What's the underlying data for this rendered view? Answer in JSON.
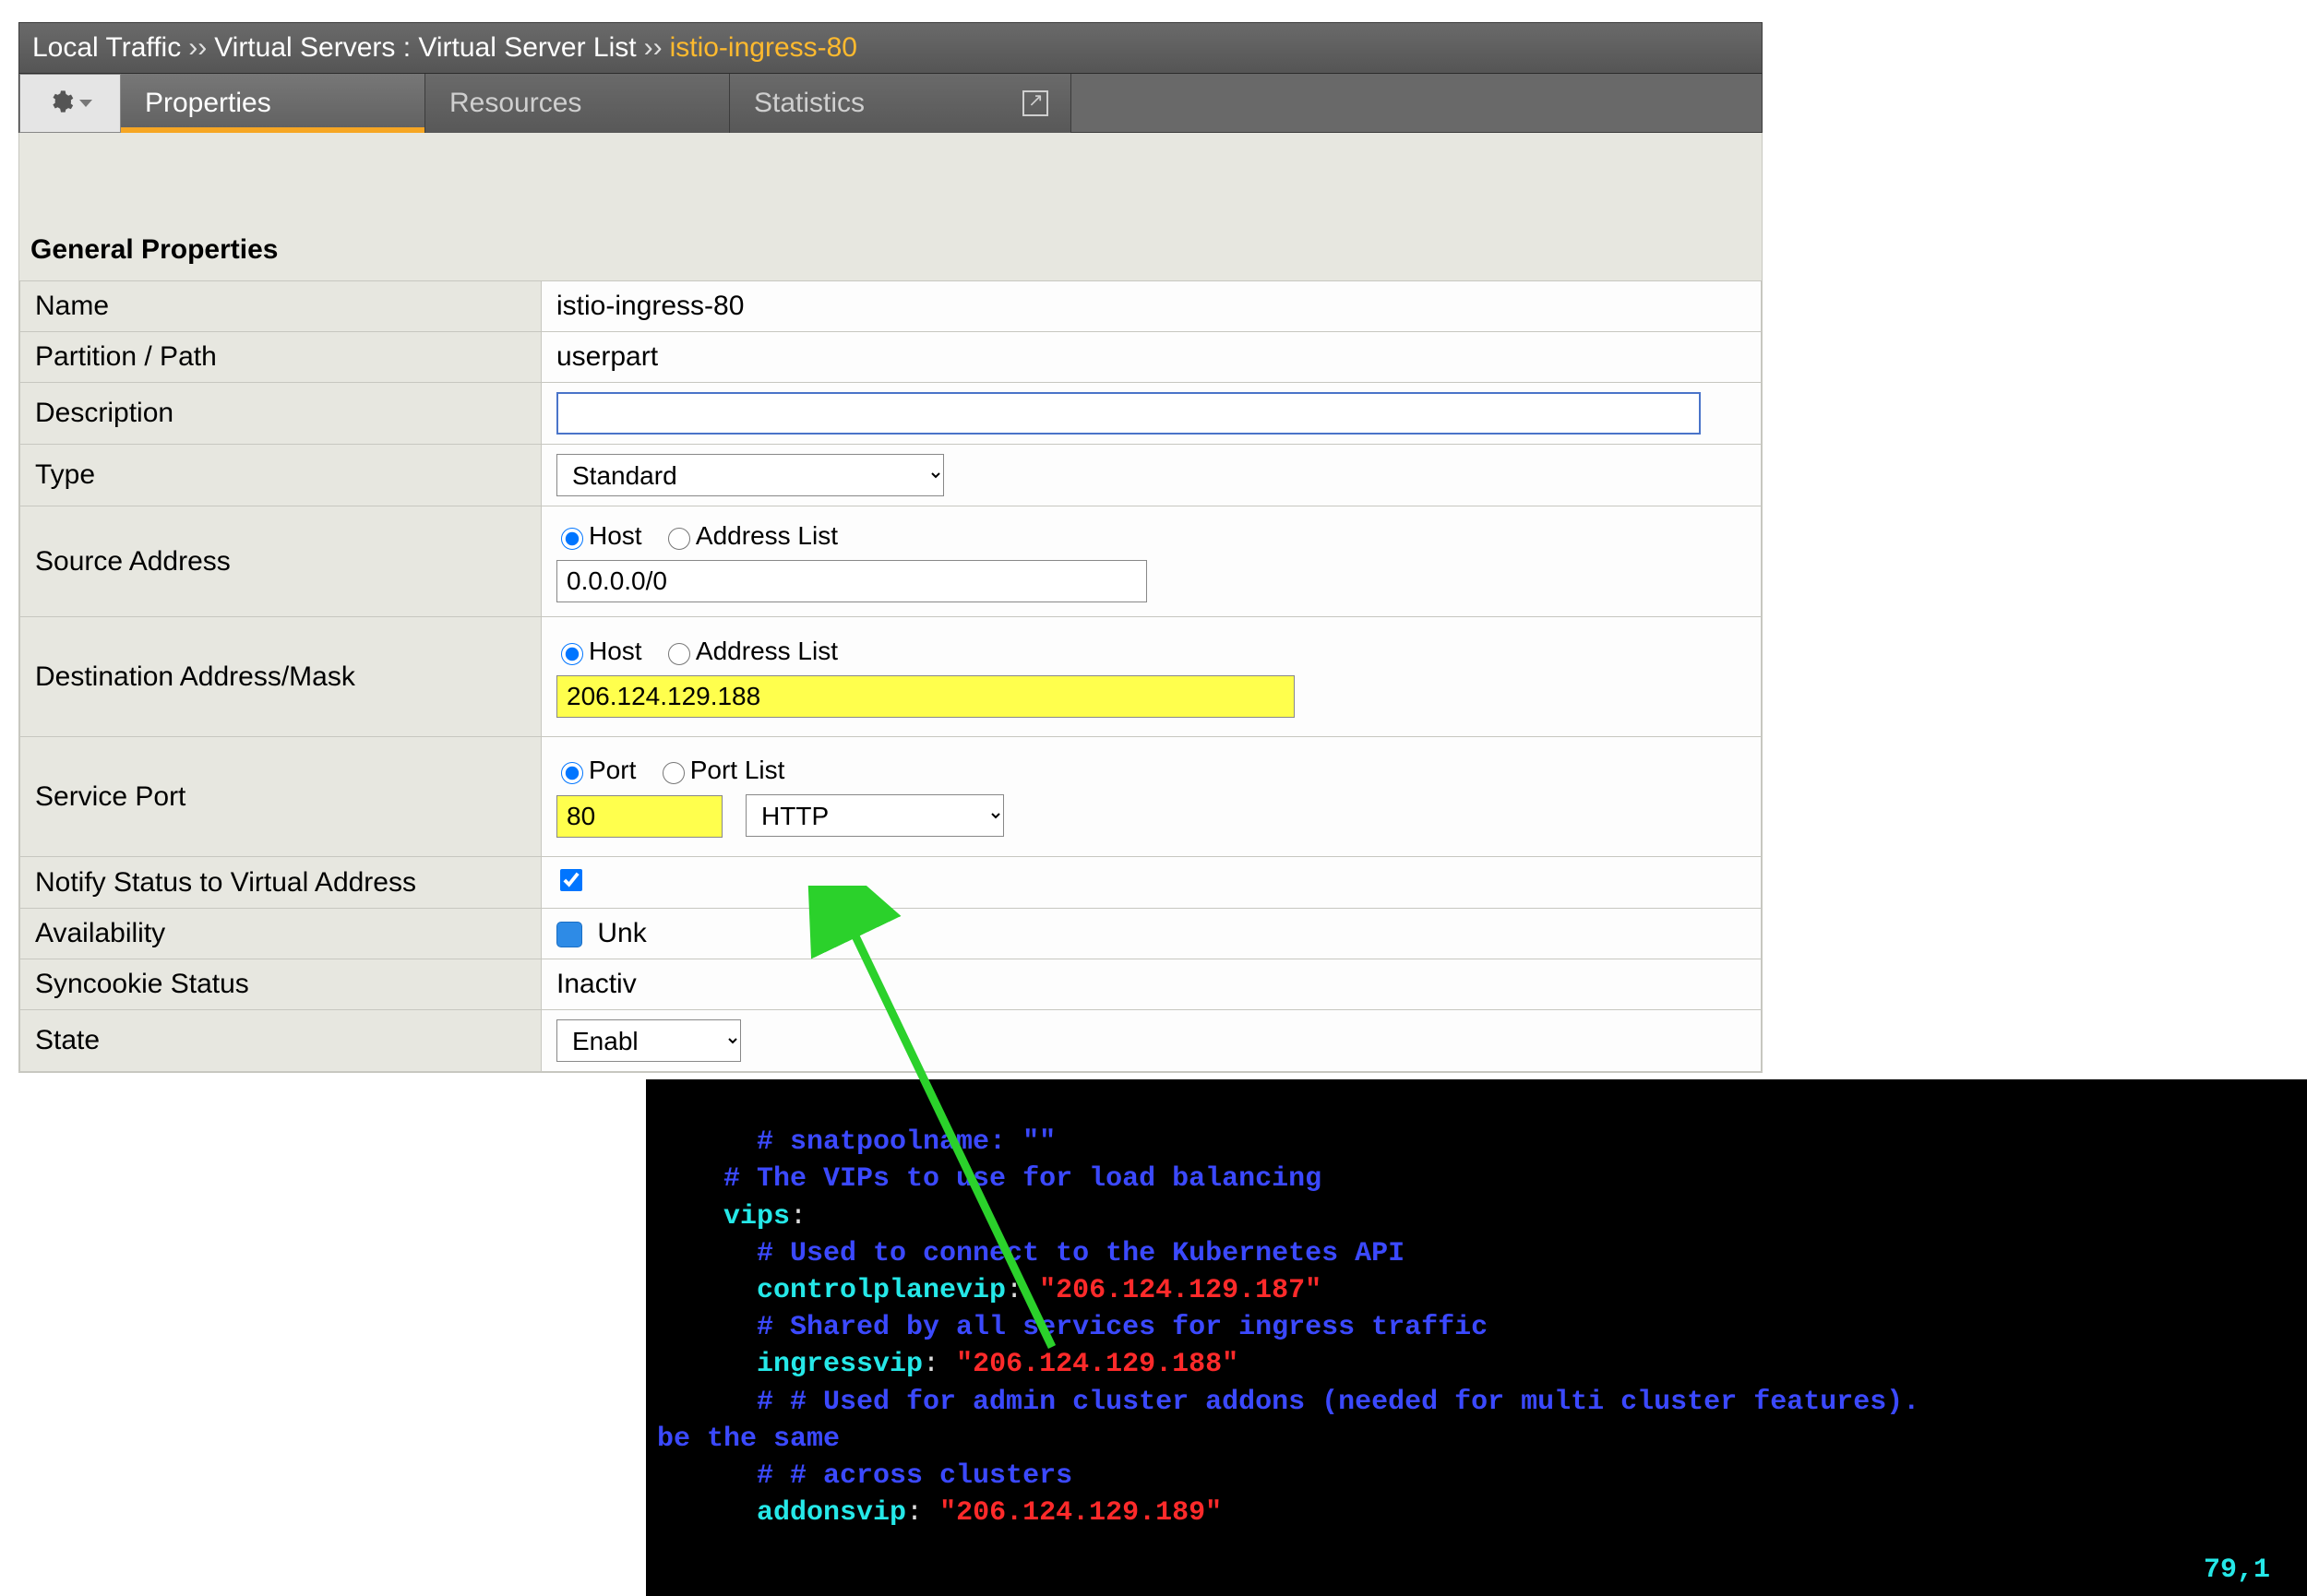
{
  "breadcrumb": {
    "root": "Local Traffic",
    "section": "Virtual Servers : Virtual Server List",
    "current": "istio-ingress-80",
    "chevron": "››"
  },
  "tabs": {
    "properties": "Properties",
    "resources": "Resources",
    "statistics": "Statistics"
  },
  "section_title": "General Properties",
  "rows": {
    "name_label": "Name",
    "name_value": "istio-ingress-80",
    "partition_label": "Partition / Path",
    "partition_value": "userpart",
    "description_label": "Description",
    "description_value": "",
    "type_label": "Type",
    "type_value": "Standard",
    "source_addr_label": "Source Address",
    "source_addr_value": "0.0.0.0/0",
    "dest_addr_label": "Destination Address/Mask",
    "dest_addr_value": "206.124.129.188",
    "service_port_label": "Service Port",
    "service_port_value": "80",
    "service_port_proto": "HTTP",
    "radio_host": "Host",
    "radio_addrlist": "Address List",
    "radio_port": "Port",
    "radio_portlist": "Port List",
    "notify_label": "Notify Status to Virtual Address",
    "availability_label": "Availability",
    "availability_value": "Unk",
    "syncookie_label": "Syncookie Status",
    "syncookie_value": "Inactiv",
    "state_label": "State",
    "state_value": "Enabl"
  },
  "terminal": {
    "l1a": "      # snatpoolname: \"\"",
    "l2a": "    # The VIPs to use for load balancing",
    "l3a": "    vips",
    "l3b": ":",
    "l4a": "      # Used to connect to the Kubernetes API",
    "l5a": "      controlplanevip",
    "l5b": ": ",
    "l5c": "\"206.124.129.187\"",
    "l6a": "      # Shared by all services for ingress traffic",
    "l7a": "      ingressvip",
    "l7b": ": ",
    "l7c": "\"206.124.129.188\"",
    "l8a": "      # # Used for admin cluster addons (needed for multi cluster features). ",
    "l8b": "be the same",
    "l9a": "      # # across clusters",
    "l10a": "      addonsvip",
    "l10b": ": ",
    "l10c": "\"206.124.129.189\"",
    "status": "79,1"
  },
  "colors": {
    "highlight": "#ffff4d",
    "tab_accent": "#f6a623",
    "breadcrumb_current": "#ffba2e",
    "arrow": "#2bd12b"
  }
}
